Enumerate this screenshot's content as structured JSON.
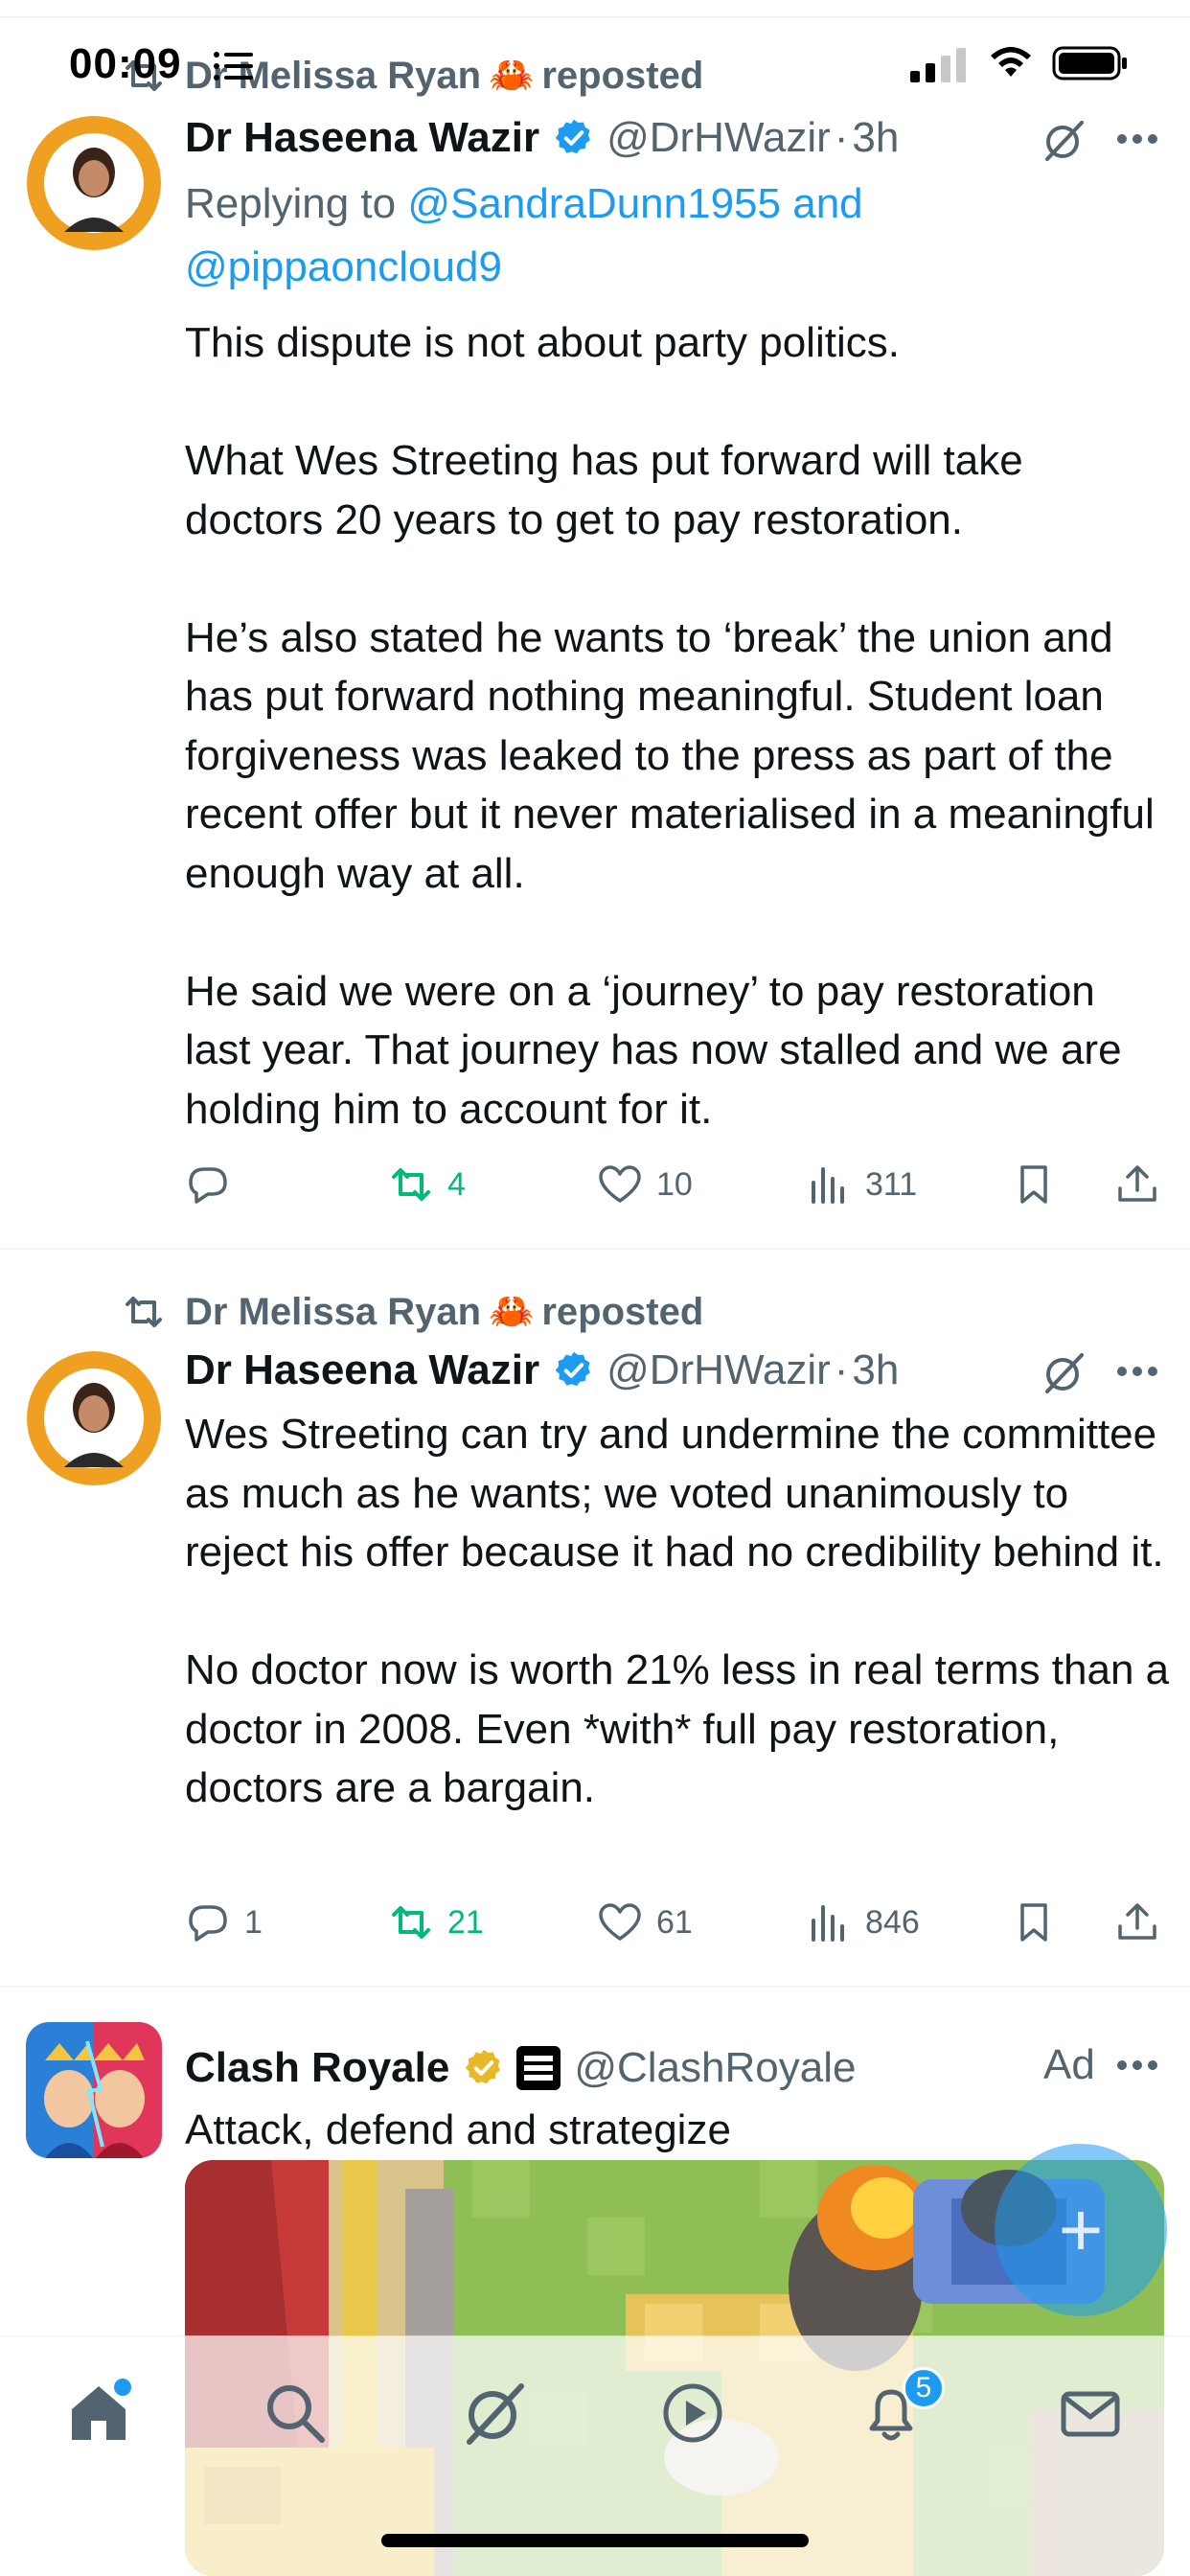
{
  "status_bar": {
    "time": "00:09",
    "icons": [
      "list-icon",
      "signal-icon",
      "wifi-icon",
      "battery-icon"
    ]
  },
  "colors": {
    "text": "#0f1419",
    "secondary": "#536471",
    "accent": "#1d9bf0",
    "repost_green": "#00ba7c",
    "verified_gold": "#e8b829",
    "divider": "#eff3f4"
  },
  "tweets": [
    {
      "reposted_by": "Dr Melissa Ryan",
      "repost_emoji": "🦀",
      "repost_suffix": "reposted",
      "author": "Dr Haseena Wazir",
      "handle": "@DrHWazir",
      "separator": "·",
      "time": "3h",
      "reply_prefix": "Replying to",
      "reply_mention_1": "@SandraDunn1955 and",
      "reply_mention_2": "@pippaoncloud9",
      "body": "This dispute is not about party politics.\n\nWhat Wes Streeting has put forward will take doctors 20 years to get to pay restoration.\n\nHe’s also stated he wants to ‘break’ the union and has put forward nothing meaningful. Student loan forgiveness was leaked to the press as part of the recent offer but it never materialised in a meaningful enough way at all.\n\nHe said we were on a ‘journey’ to pay restoration last year. That journey has now stalled and we are holding him to account for it.",
      "replies": "",
      "reposts": "4",
      "likes": "10",
      "views": "311"
    },
    {
      "reposted_by": "Dr Melissa Ryan",
      "repost_emoji": "🦀",
      "repost_suffix": "reposted",
      "author": "Dr Haseena Wazir",
      "handle": "@DrHWazir",
      "separator": "·",
      "time": "3h",
      "body": "Wes Streeting can try and undermine the committee as much as he wants; we voted unanimously to reject his offer because it had no credibility behind it.\n\nNo doctor now is worth 21% less in real terms than a doctor in 2008. Even *with* full pay restoration, doctors are a bargain.",
      "replies": "1",
      "reposts": "21",
      "likes": "61",
      "views": "846"
    }
  ],
  "ad": {
    "author": "Clash Royale",
    "handle": "@ClashRoyale",
    "label": "Ad",
    "body": "Attack, defend and strategize"
  },
  "fab": {
    "label": "+"
  },
  "bottom_nav": {
    "items": [
      "home",
      "search",
      "grok",
      "video",
      "notifications",
      "messages"
    ],
    "notification_count": "5"
  }
}
